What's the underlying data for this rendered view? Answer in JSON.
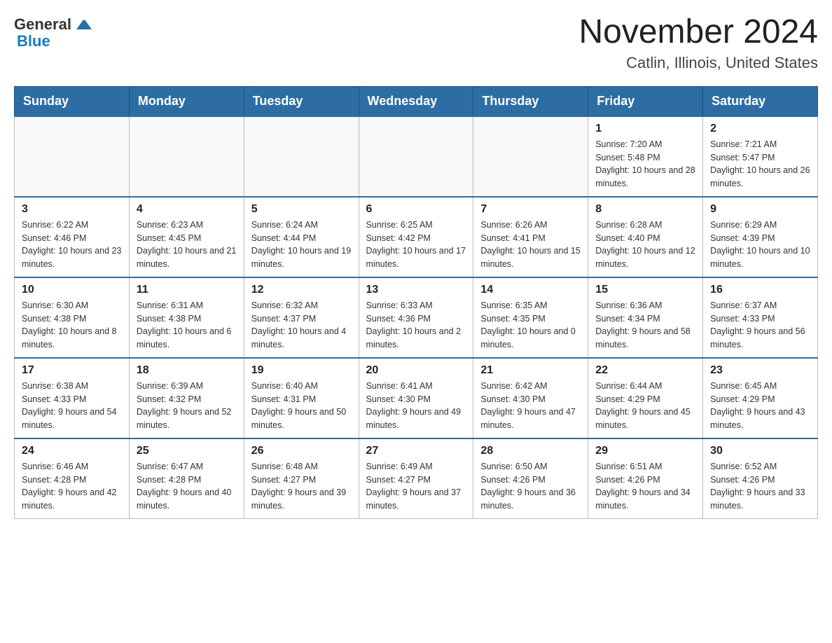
{
  "header": {
    "logo": {
      "text_general": "General",
      "text_blue": "Blue"
    },
    "title": "November 2024",
    "location": "Catlin, Illinois, United States"
  },
  "days_of_week": [
    "Sunday",
    "Monday",
    "Tuesday",
    "Wednesday",
    "Thursday",
    "Friday",
    "Saturday"
  ],
  "weeks": [
    [
      {
        "day": "",
        "info": ""
      },
      {
        "day": "",
        "info": ""
      },
      {
        "day": "",
        "info": ""
      },
      {
        "day": "",
        "info": ""
      },
      {
        "day": "",
        "info": ""
      },
      {
        "day": "1",
        "info": "Sunrise: 7:20 AM\nSunset: 5:48 PM\nDaylight: 10 hours and 28 minutes."
      },
      {
        "day": "2",
        "info": "Sunrise: 7:21 AM\nSunset: 5:47 PM\nDaylight: 10 hours and 26 minutes."
      }
    ],
    [
      {
        "day": "3",
        "info": "Sunrise: 6:22 AM\nSunset: 4:46 PM\nDaylight: 10 hours and 23 minutes."
      },
      {
        "day": "4",
        "info": "Sunrise: 6:23 AM\nSunset: 4:45 PM\nDaylight: 10 hours and 21 minutes."
      },
      {
        "day": "5",
        "info": "Sunrise: 6:24 AM\nSunset: 4:44 PM\nDaylight: 10 hours and 19 minutes."
      },
      {
        "day": "6",
        "info": "Sunrise: 6:25 AM\nSunset: 4:42 PM\nDaylight: 10 hours and 17 minutes."
      },
      {
        "day": "7",
        "info": "Sunrise: 6:26 AM\nSunset: 4:41 PM\nDaylight: 10 hours and 15 minutes."
      },
      {
        "day": "8",
        "info": "Sunrise: 6:28 AM\nSunset: 4:40 PM\nDaylight: 10 hours and 12 minutes."
      },
      {
        "day": "9",
        "info": "Sunrise: 6:29 AM\nSunset: 4:39 PM\nDaylight: 10 hours and 10 minutes."
      }
    ],
    [
      {
        "day": "10",
        "info": "Sunrise: 6:30 AM\nSunset: 4:38 PM\nDaylight: 10 hours and 8 minutes."
      },
      {
        "day": "11",
        "info": "Sunrise: 6:31 AM\nSunset: 4:38 PM\nDaylight: 10 hours and 6 minutes."
      },
      {
        "day": "12",
        "info": "Sunrise: 6:32 AM\nSunset: 4:37 PM\nDaylight: 10 hours and 4 minutes."
      },
      {
        "day": "13",
        "info": "Sunrise: 6:33 AM\nSunset: 4:36 PM\nDaylight: 10 hours and 2 minutes."
      },
      {
        "day": "14",
        "info": "Sunrise: 6:35 AM\nSunset: 4:35 PM\nDaylight: 10 hours and 0 minutes."
      },
      {
        "day": "15",
        "info": "Sunrise: 6:36 AM\nSunset: 4:34 PM\nDaylight: 9 hours and 58 minutes."
      },
      {
        "day": "16",
        "info": "Sunrise: 6:37 AM\nSunset: 4:33 PM\nDaylight: 9 hours and 56 minutes."
      }
    ],
    [
      {
        "day": "17",
        "info": "Sunrise: 6:38 AM\nSunset: 4:33 PM\nDaylight: 9 hours and 54 minutes."
      },
      {
        "day": "18",
        "info": "Sunrise: 6:39 AM\nSunset: 4:32 PM\nDaylight: 9 hours and 52 minutes."
      },
      {
        "day": "19",
        "info": "Sunrise: 6:40 AM\nSunset: 4:31 PM\nDaylight: 9 hours and 50 minutes."
      },
      {
        "day": "20",
        "info": "Sunrise: 6:41 AM\nSunset: 4:30 PM\nDaylight: 9 hours and 49 minutes."
      },
      {
        "day": "21",
        "info": "Sunrise: 6:42 AM\nSunset: 4:30 PM\nDaylight: 9 hours and 47 minutes."
      },
      {
        "day": "22",
        "info": "Sunrise: 6:44 AM\nSunset: 4:29 PM\nDaylight: 9 hours and 45 minutes."
      },
      {
        "day": "23",
        "info": "Sunrise: 6:45 AM\nSunset: 4:29 PM\nDaylight: 9 hours and 43 minutes."
      }
    ],
    [
      {
        "day": "24",
        "info": "Sunrise: 6:46 AM\nSunset: 4:28 PM\nDaylight: 9 hours and 42 minutes."
      },
      {
        "day": "25",
        "info": "Sunrise: 6:47 AM\nSunset: 4:28 PM\nDaylight: 9 hours and 40 minutes."
      },
      {
        "day": "26",
        "info": "Sunrise: 6:48 AM\nSunset: 4:27 PM\nDaylight: 9 hours and 39 minutes."
      },
      {
        "day": "27",
        "info": "Sunrise: 6:49 AM\nSunset: 4:27 PM\nDaylight: 9 hours and 37 minutes."
      },
      {
        "day": "28",
        "info": "Sunrise: 6:50 AM\nSunset: 4:26 PM\nDaylight: 9 hours and 36 minutes."
      },
      {
        "day": "29",
        "info": "Sunrise: 6:51 AM\nSunset: 4:26 PM\nDaylight: 9 hours and 34 minutes."
      },
      {
        "day": "30",
        "info": "Sunrise: 6:52 AM\nSunset: 4:26 PM\nDaylight: 9 hours and 33 minutes."
      }
    ]
  ]
}
